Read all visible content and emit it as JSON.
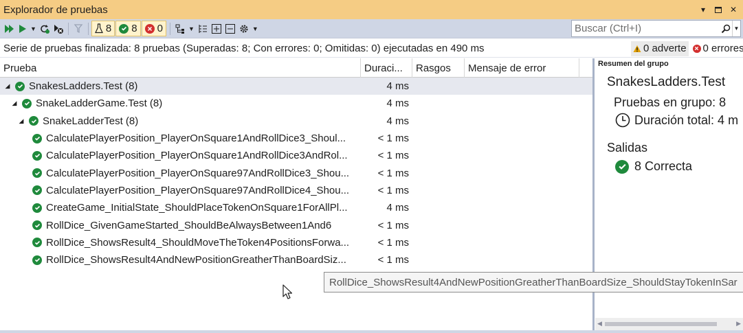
{
  "window": {
    "title": "Explorador de pruebas"
  },
  "toolbar": {
    "total_count": "8",
    "passed_count": "8",
    "failed_count": "0",
    "search_placeholder": "Buscar (Ctrl+I)"
  },
  "status": {
    "summary": "Serie de pruebas finalizada: 8 pruebas (Superadas: 8; Con errores: 0; Omitidas: 0) ejecutadas en 490 ms",
    "warnings": "0 adverte",
    "errors": "0 errores"
  },
  "grid": {
    "columns": [
      "Prueba",
      "Duraci...",
      "Rasgos",
      "Mensaje de error"
    ],
    "rows": [
      {
        "name": "SnakesLadders.Test (8)",
        "duration": "4 ms"
      },
      {
        "name": "SnakeLadderGame.Test (8)",
        "duration": "4 ms"
      },
      {
        "name": "SnakeLadderTest (8)",
        "duration": "4 ms"
      },
      {
        "name": "CalculatePlayerPosition_PlayerOnSquare1AndRollDice3_Shoul...",
        "duration": "< 1 ms"
      },
      {
        "name": "CalculatePlayerPosition_PlayerOnSquare1AndRollDice3AndRol...",
        "duration": "< 1 ms"
      },
      {
        "name": "CalculatePlayerPosition_PlayerOnSquare97AndRollDice3_Shou...",
        "duration": "< 1 ms"
      },
      {
        "name": "CalculatePlayerPosition_PlayerOnSquare97AndRollDice4_Shou...",
        "duration": "< 1 ms"
      },
      {
        "name": "CreateGame_InitialState_ShouldPlaceTokenOnSquare1ForAllPl...",
        "duration": "4 ms"
      },
      {
        "name": "RollDice_GivenGameStarted_ShouldBeAlwaysBetween1And6",
        "duration": "< 1 ms"
      },
      {
        "name": "RollDice_ShowsResult4_ShouldMoveTheToken4PositionsForwa...",
        "duration": "< 1 ms"
      },
      {
        "name": "RollDice_ShowsResult4AndNewPositionGreatherThanBoardSiz...",
        "duration": "< 1 ms"
      }
    ]
  },
  "tooltip": {
    "text": "RollDice_ShowsResult4AndNewPositionGreatherThanBoardSize_ShouldStayTokenInSar"
  },
  "detail": {
    "header": "Resumen del grupo",
    "group_name": "SnakesLadders.Test",
    "tests_in_group": "Pruebas en grupo: 8",
    "total_duration": "Duración total: 4 m",
    "outputs_label": "Salidas",
    "passed": "8 Correcta"
  },
  "colors": {
    "title_bar": "#f5cc84",
    "toolbar": "#cfd6e5",
    "pass_green": "#1f8a3c",
    "fail_red": "#d32f2f",
    "selected_row": "#e6e8ef"
  }
}
